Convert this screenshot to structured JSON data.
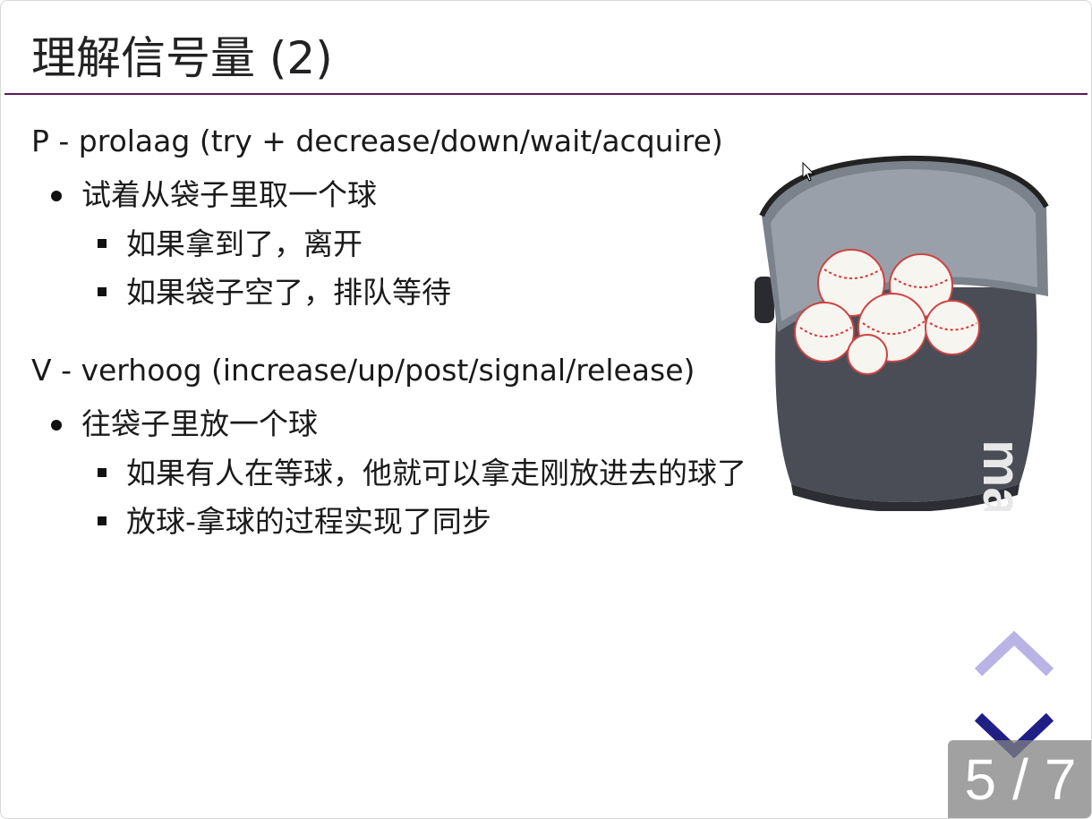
{
  "slide": {
    "title": "理解信号量 (2)",
    "p_heading": "P - prolaag (try + decrease/down/wait/acquire)",
    "p_bullet": "试着从袋子里取一个球",
    "p_sub": [
      "如果拿到了，离开",
      "如果袋子空了，排队等待"
    ],
    "v_heading": "V - verhoog (increase/up/post/signal/release)",
    "v_bullet": "往袋子里放一个球",
    "v_sub": [
      "如果有人在等球，他就可以拿走刚放进去的球了",
      "放球-拿球的过程实现了同步"
    ],
    "image_brand_text": "macron"
  },
  "navigation": {
    "up_icon": "chevron-up-icon",
    "down_icon": "chevron-down-icon",
    "up_color": "#b9b3e6",
    "down_color": "#1f1f85",
    "current_page": "5",
    "separator": "/",
    "total_pages": "7"
  },
  "colors": {
    "title_rule": "#5b1b56",
    "bag": "#4a4d55",
    "bag_inner": "#8a8f98"
  }
}
